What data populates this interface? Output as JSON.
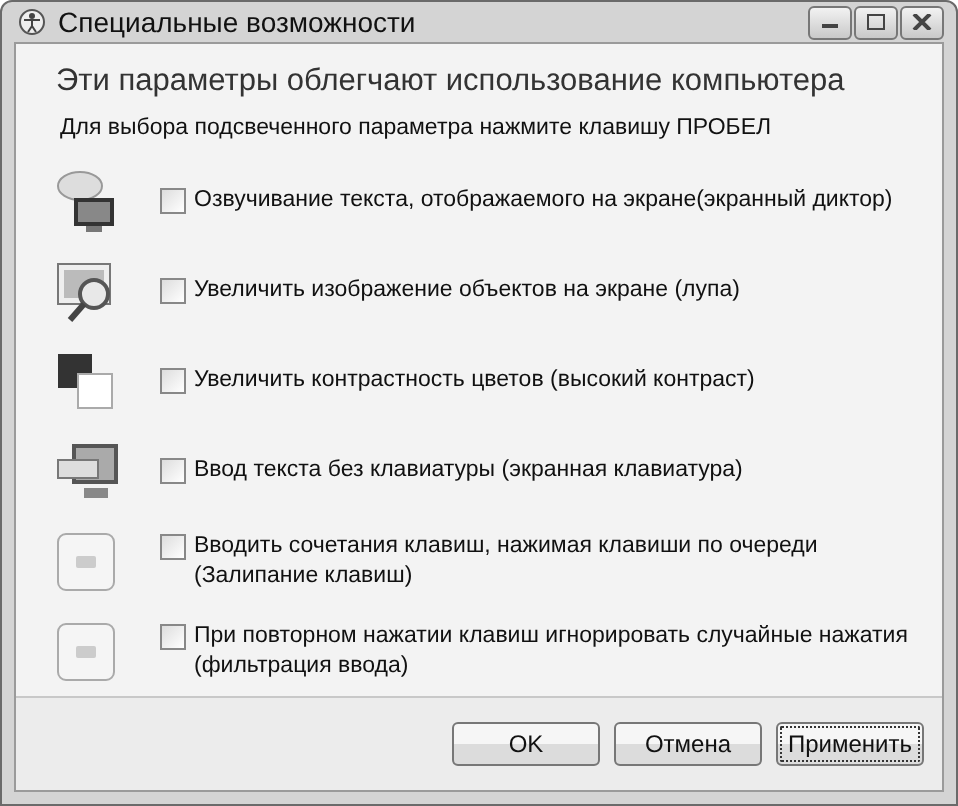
{
  "window": {
    "title": "Специальные возможности"
  },
  "heading": "Эти параметры облегчают использование компьютера",
  "hint": "Для выбора подсвеченного параметра нажмите клавишу ПРОБЕЛ",
  "options": [
    {
      "kind": "narrator",
      "label": "Озвучивание текста, отображаемого на экране(экранный диктор)",
      "checked": false
    },
    {
      "kind": "magnifier",
      "label": "Увеличить изображение объектов на экране (лупа)",
      "checked": false
    },
    {
      "kind": "contrast",
      "label": "Увеличить контрастность цветов (высокий контраст)",
      "checked": false
    },
    {
      "kind": "keyboard",
      "label": "Ввод текста без клавиатуры (экранная клавиатура)",
      "checked": false
    },
    {
      "kind": "key",
      "label": "Вводить сочетания клавиш, нажимая клавиши по очереди (Залипание клавиш)",
      "checked": false
    },
    {
      "kind": "key",
      "label": "При повторном нажатии клавиш игнорировать случайные нажатия (фильтрация ввода)",
      "checked": false
    }
  ],
  "buttons": [
    {
      "label": "OK",
      "focused": false
    },
    {
      "label": "Отмена",
      "focused": false
    },
    {
      "label": "Применить",
      "focused": true
    }
  ]
}
